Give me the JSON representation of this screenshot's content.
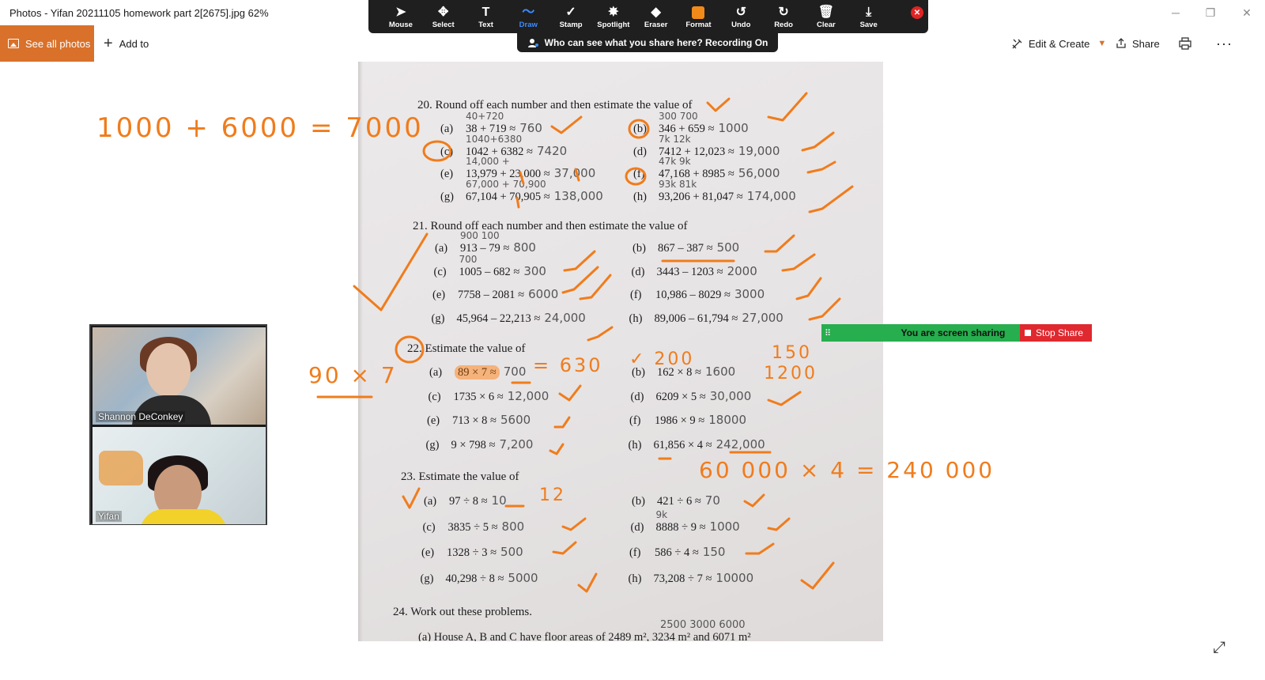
{
  "window": {
    "title": "Photos - Yifan 20211105 homework part 2[2675].jpg   62%",
    "minimize_glyph": "─",
    "maximize_glyph": "❐",
    "close_glyph": "✕"
  },
  "commandbar": {
    "see_all_photos": "See all photos",
    "add_to": "Add to",
    "edit_create": "Edit & Create",
    "share": "Share",
    "more": "···"
  },
  "zoom_toolbar": {
    "tools": [
      {
        "label": "Mouse",
        "icon": "mouse-pointer-icon",
        "glyph": "➤"
      },
      {
        "label": "Select",
        "icon": "select-move-icon",
        "glyph": "✥"
      },
      {
        "label": "Text",
        "icon": "text-icon",
        "glyph": "T"
      },
      {
        "label": "Draw",
        "icon": "draw-squiggle-icon",
        "glyph": "〜"
      },
      {
        "label": "Stamp",
        "icon": "stamp-check-icon",
        "glyph": "✓"
      },
      {
        "label": "Spotlight",
        "icon": "spotlight-icon",
        "glyph": "✸"
      },
      {
        "label": "Eraser",
        "icon": "eraser-icon",
        "glyph": "◆"
      },
      {
        "label": "Format",
        "icon": "format-color-icon",
        "glyph": ""
      },
      {
        "label": "Undo",
        "icon": "undo-icon",
        "glyph": "↺"
      },
      {
        "label": "Redo",
        "icon": "redo-icon",
        "glyph": "↻"
      },
      {
        "label": "Clear",
        "icon": "trash-icon",
        "glyph": "🗑"
      },
      {
        "label": "Save",
        "icon": "save-download-icon",
        "glyph": "⤓"
      }
    ],
    "active_tool": "Draw",
    "close_glyph": "✕",
    "recording_text": "Who can see what you share here? Recording On",
    "accent_color": "#3b8cff",
    "format_color": "#f28a1a"
  },
  "worksheet": {
    "q20": {
      "title": "20.  Round off each number and then estimate the value of",
      "items": [
        {
          "label": "(a)",
          "expr": "38 + 719 ≈",
          "hand": "760",
          "above": "40+720"
        },
        {
          "label": "(b)",
          "expr": "346 + 659 ≈",
          "hand": "1000",
          "above": "300  700"
        },
        {
          "label": "(c)",
          "expr": "1042 + 6382 ≈",
          "hand": "7420",
          "above": "1040+6380"
        },
        {
          "label": "(d)",
          "expr": "7412 + 12,023 ≈",
          "hand": "19,000",
          "above": "7k    12k"
        },
        {
          "label": "(e)",
          "expr": "13,979 + 23,000 ≈",
          "hand": "37,000",
          "above": "14,000 +"
        },
        {
          "label": "(f)",
          "expr": "47,168 + 8985 ≈",
          "hand": "56,000",
          "above": "47k  9k"
        },
        {
          "label": "(g)",
          "expr": "67,104 + 70,905 ≈",
          "hand": "138,000",
          "above": "67,000 + 70,900"
        },
        {
          "label": "(h)",
          "expr": "93,206 + 81,047 ≈",
          "hand": "174,000",
          "above": "93k   81k"
        }
      ]
    },
    "q21": {
      "title": "21.  Round off each number and then estimate the value of",
      "items": [
        {
          "label": "(a)",
          "expr": "913 – 79 ≈",
          "hand": "800",
          "above": "900  100"
        },
        {
          "label": "(b)",
          "expr": "867 – 387 ≈",
          "hand": "500",
          "above": ""
        },
        {
          "label": "(c)",
          "expr": "1005 – 682 ≈",
          "hand": "300",
          "above": "700"
        },
        {
          "label": "(d)",
          "expr": "3443 – 1203 ≈",
          "hand": "2000",
          "above": ""
        },
        {
          "label": "(e)",
          "expr": "7758 – 2081 ≈",
          "hand": "6000",
          "above": ""
        },
        {
          "label": "(f)",
          "expr": "10,986 – 8029 ≈",
          "hand": "3000",
          "above": ""
        },
        {
          "label": "(g)",
          "expr": "45,964 – 22,213 ≈",
          "hand": "24,000",
          "above": ""
        },
        {
          "label": "(h)",
          "expr": "89,006 – 61,794 ≈",
          "hand": "27,000",
          "above": ""
        }
      ]
    },
    "q22": {
      "title": "22.  Estimate the value of",
      "items": [
        {
          "label": "(a)",
          "expr": "89 × 7 ≈",
          "hand": "700",
          "above": ""
        },
        {
          "label": "(b)",
          "expr": "162 × 8 ≈",
          "hand": "1600",
          "above": ""
        },
        {
          "label": "(c)",
          "expr": "1735 × 6 ≈",
          "hand": "12,000",
          "above": ""
        },
        {
          "label": "(d)",
          "expr": "6209 × 5 ≈",
          "hand": "30,000",
          "above": ""
        },
        {
          "label": "(e)",
          "expr": "713 × 8 ≈",
          "hand": "5600",
          "above": ""
        },
        {
          "label": "(f)",
          "expr": "1986 × 9 ≈",
          "hand": "18000",
          "above": ""
        },
        {
          "label": "(g)",
          "expr": "9 × 798 ≈",
          "hand": "7,200",
          "above": ""
        },
        {
          "label": "(h)",
          "expr": "61,856 × 4 ≈",
          "hand": "242,000",
          "above": ""
        }
      ]
    },
    "q23": {
      "title": "23.  Estimate the value of",
      "items": [
        {
          "label": "(a)",
          "expr": "97 ÷ 8 ≈",
          "hand": "10",
          "above": ""
        },
        {
          "label": "(b)",
          "expr": "421 ÷ 6 ≈",
          "hand": "70",
          "above": ""
        },
        {
          "label": "(c)",
          "expr": "3835 ÷ 5 ≈",
          "hand": "800",
          "above": ""
        },
        {
          "label": "(d)",
          "expr": "8888 ÷ 9 ≈",
          "hand": "1000",
          "above": "9k"
        },
        {
          "label": "(e)",
          "expr": "1328 ÷ 3 ≈",
          "hand": "500",
          "above": ""
        },
        {
          "label": "(f)",
          "expr": "586 ÷ 4 ≈",
          "hand": "150",
          "above": ""
        },
        {
          "label": "(g)",
          "expr": "40,298 ÷ 8 ≈",
          "hand": "5000",
          "above": ""
        },
        {
          "label": "(h)",
          "expr": "73,208 ÷ 7 ≈",
          "hand": "10000",
          "above": ""
        }
      ]
    },
    "q24": {
      "title": "24.  Work out these problems.",
      "line_a": "(a)    House A, B and C have floor areas of 2489 m², 3234 m² and 6071 m²",
      "above_a": "2500      3000          6000"
    }
  },
  "annotations": {
    "top_left_equation": "1000 + 6000 = 7000",
    "left_note": "90 × 7",
    "q22a_result": "= 630",
    "q22b_note": "✓ 200",
    "q22b_right_top": "150",
    "q22b_right_bottom": "1200",
    "q22h_equation": "60 000 × 4 = 240 000",
    "q23a_extra": "12",
    "ink_color": "#f07c1c"
  },
  "gallery": {
    "participant_1": "Shannon DeConkey",
    "participant_2": "Yifan"
  },
  "sharing": {
    "status": "You are screen sharing",
    "stop_label": "Stop Share",
    "bar_color": "#27ae4e",
    "stop_color": "#e0282f"
  },
  "expand_glyph": "⤢"
}
